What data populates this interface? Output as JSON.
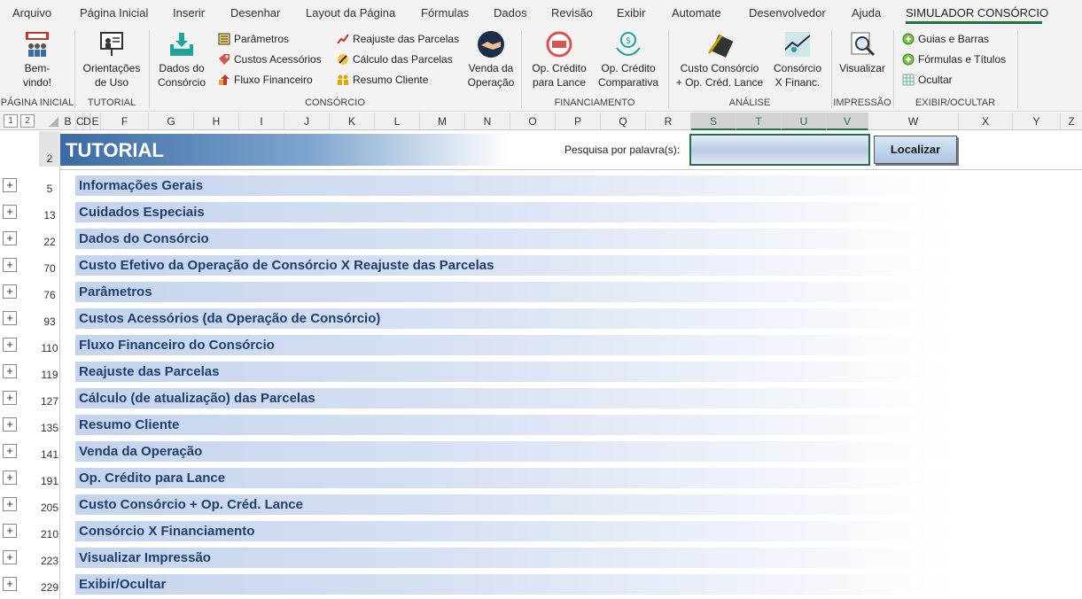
{
  "menu": {
    "tabs": [
      "Arquivo",
      "Página Inicial",
      "Inserir",
      "Desenhar",
      "Layout da Página",
      "Fórmulas",
      "Dados",
      "Revisão",
      "Exibir",
      "Automate",
      "Desenvolvedor",
      "Ajuda",
      "SIMULADOR CONSÓRCIO"
    ]
  },
  "ribbon": {
    "groups": {
      "pagina_inicial": "PÁGINA INICIAL",
      "tutorial": "TUTORIAL",
      "consorcio": "CONSÓRCIO",
      "financiamento": "FINANCIAMENTO",
      "analise": "ANÁLISE",
      "impressao": "IMPRESSÃO",
      "exibir_ocultar": "EXIBIR/OCULTAR"
    },
    "buttons": {
      "bemvindo": [
        "Bem-",
        "vindo!"
      ],
      "orientacoes": [
        "Orientações",
        "de Uso"
      ],
      "dados": [
        "Dados do",
        "Consórcio"
      ],
      "parametros": "Parâmetros",
      "custos": "Custos Acessórios",
      "fluxo": "Fluxo Financeiro",
      "reajuste": "Reajuste das Parcelas",
      "calculo": "Cálculo das Parcelas",
      "resumo": "Resumo Cliente",
      "venda": [
        "Venda da",
        "Operação"
      ],
      "opcredito": [
        "Op. Crédito",
        "para Lance"
      ],
      "opcomparativa": [
        "Op. Crédito",
        "Comparativa"
      ],
      "custoconsorcio": [
        "Custo Consórcio",
        "+ Op. Créd. Lance"
      ],
      "consorciox": [
        "Consórcio",
        "X Financ."
      ],
      "visualizar": "Visualizar",
      "guias": "Guias e Barras",
      "formulas": "Fórmulas e Títulos",
      "ocultar": "Ocultar"
    }
  },
  "grid": {
    "outline_levels": [
      "1",
      "2"
    ],
    "columns": [
      "B",
      "C",
      "D",
      "E",
      "F",
      "G",
      "H",
      "I",
      "J",
      "K",
      "L",
      "M",
      "N",
      "O",
      "P",
      "Q",
      "R",
      "S",
      "T",
      "U",
      "V",
      "W",
      "X",
      "Y",
      "Z"
    ]
  },
  "tutorial": {
    "title": "TUTORIAL",
    "search_label": "Pesquisa por palavra(s):",
    "search_value": "",
    "find_button": "Localizar",
    "header_row": "2"
  },
  "topics": [
    {
      "row": "5",
      "label": "Informações Gerais"
    },
    {
      "row": "13",
      "label": "Cuidados Especiais"
    },
    {
      "row": "22",
      "label": "Dados do Consórcio"
    },
    {
      "row": "70",
      "label": "Custo Efetivo da Operação de Consórcio X Reajuste das Parcelas"
    },
    {
      "row": "76",
      "label": "Parâmetros"
    },
    {
      "row": "93",
      "label": "Custos Acessórios (da Operação de Consórcio)"
    },
    {
      "row": "110",
      "label": "Fluxo Financeiro do Consórcio"
    },
    {
      "row": "119",
      "label": "Reajuste das Parcelas"
    },
    {
      "row": "127",
      "label": "Cálculo (de atualização) das Parcelas"
    },
    {
      "row": "135",
      "label": "Resumo Cliente"
    },
    {
      "row": "141",
      "label": "Venda da Operação"
    },
    {
      "row": "191",
      "label": "Op. Crédito para Lance"
    },
    {
      "row": "205",
      "label": "Custo Consórcio + Op. Créd. Lance"
    },
    {
      "row": "210",
      "label": "Consórcio X Financiamento"
    },
    {
      "row": "223",
      "label": "Visualizar Impressão"
    },
    {
      "row": "229",
      "label": "Exibir/Ocultar"
    }
  ],
  "colors": {
    "accent": "#217346",
    "header_blue": "#3b6aa4",
    "topic_text": "#1f3f6e"
  }
}
